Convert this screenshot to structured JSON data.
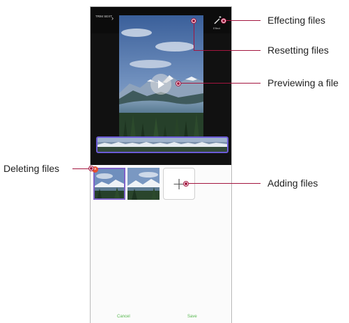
{
  "callouts": {
    "effecting": "Effecting files",
    "resetting": "Resetting files",
    "previewing": "Previewing a file",
    "deleting": "Deleting files",
    "adding": "Adding files"
  },
  "editor": {
    "header_text": "TRIM SEXT",
    "effect_label": "Effect",
    "cancel_label": "Cancel",
    "save_label": "Save"
  },
  "icons": {
    "wand": "magic-wand-icon",
    "reset": "reset-icon",
    "play": "play-icon",
    "delete": "delete-icon",
    "add": "plus-icon"
  },
  "colors": {
    "callout": "#a3153f",
    "selection": "#6b5bd6",
    "delete_badge": "#e8502f",
    "footer_text": "#57b84f"
  }
}
